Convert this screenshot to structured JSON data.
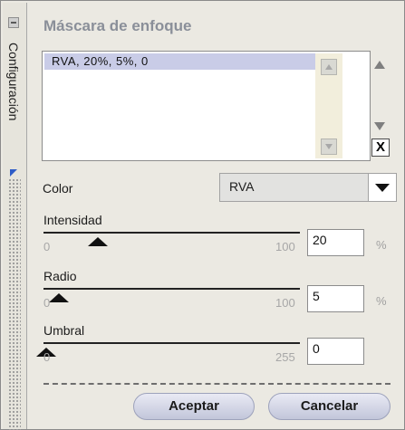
{
  "panel": {
    "title": "Máscara de enfoque",
    "side_tab": "Configuración"
  },
  "list": {
    "items": [
      "RVA, 20%, 5%, 0"
    ],
    "delete_label": "X"
  },
  "color": {
    "label": "Color",
    "value": "RVA"
  },
  "sliders": [
    {
      "label": "Intensidad",
      "min": "0",
      "max": "100",
      "value": "20",
      "unit": "%",
      "fraction": 0.2
    },
    {
      "label": "Radio",
      "min": "0",
      "max": "100",
      "value": "5",
      "unit": "%",
      "fraction": 0.05
    },
    {
      "label": "Umbral",
      "min": "0",
      "max": "255",
      "value": "0",
      "unit": "",
      "fraction": 0.0
    }
  ],
  "buttons": {
    "accept": "Aceptar",
    "cancel": "Cancelar"
  }
}
